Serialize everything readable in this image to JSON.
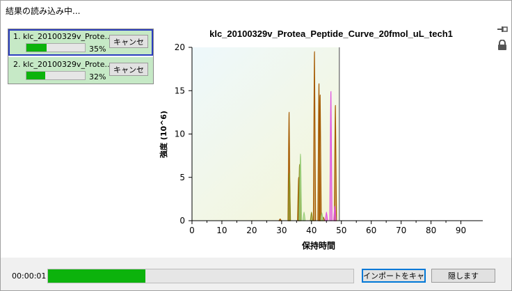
{
  "window": {
    "title": "結果の読み込み中..."
  },
  "jobs": [
    {
      "name": "1. klc_20100329v_Prote...",
      "progress_pct": 35,
      "pct_label": "35%",
      "cancel_label": "キャンセ",
      "selected": true
    },
    {
      "name": "2. klc_20100329v_Prote...",
      "progress_pct": 32,
      "pct_label": "32%",
      "cancel_label": "キャンセ",
      "selected": false
    }
  ],
  "icons": {
    "pin": "pin-icon",
    "lock": "lock-icon"
  },
  "chart_data": {
    "type": "line",
    "title": "klc_20100329v_Protea_Peptide_Curve_20fmol_uL_tech1",
    "xlabel": "保持時間",
    "ylabel": "強度 (10^6)",
    "xlim": [
      0,
      95
    ],
    "ylim": [
      0,
      20
    ],
    "xticks": [
      0,
      10,
      20,
      30,
      40,
      50,
      60,
      70,
      80,
      90
    ],
    "yticks": [
      0,
      5,
      10,
      15,
      20
    ],
    "acquired_until": 49.3,
    "series": [
      {
        "color": "#a55a00",
        "peaks": [
          [
            32.5,
            12.5
          ],
          [
            35.7,
            5.0
          ],
          [
            41.0,
            19.5
          ],
          [
            42.5,
            15.8
          ],
          [
            42.9,
            14.5
          ],
          [
            48.0,
            13.3
          ],
          [
            29.5,
            0.2
          ],
          [
            44.0,
            0.4
          ]
        ]
      },
      {
        "color": "#8c8c1e",
        "peaks": [
          [
            32.6,
            5.5
          ],
          [
            36.0,
            6.5
          ],
          [
            40.0,
            1.0
          ]
        ]
      },
      {
        "color": "#9acd7a",
        "peaks": [
          [
            36.3,
            7.7
          ],
          [
            37.5,
            1.0
          ],
          [
            43.5,
            0.9
          ]
        ]
      },
      {
        "color": "#e050e0",
        "peaks": [
          [
            46.5,
            14.9
          ],
          [
            47.8,
            1.7
          ],
          [
            45.0,
            1.0
          ]
        ]
      }
    ]
  },
  "footer": {
    "elapsed": "00:00:01",
    "progress_pct": 32,
    "import_label": "インポートをキャ",
    "hide_label": "隠します"
  }
}
